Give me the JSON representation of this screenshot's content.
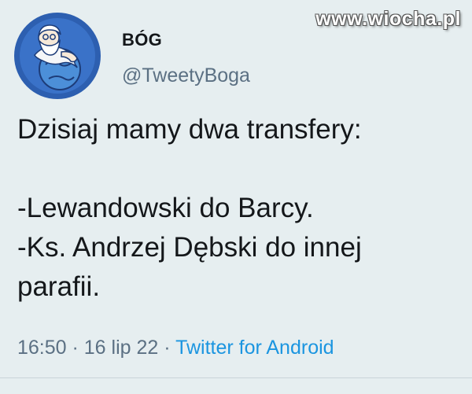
{
  "watermark": "www.wiocha.pl",
  "author": {
    "name": "BÓG",
    "handle": "@TweetyBoga",
    "avatar_icon": "god-figure-avatar"
  },
  "tweet": {
    "lines": [
      "Dzisiaj mamy dwa transfery:",
      "",
      "-Lewandowski do Barcy.",
      "-Ks. Andrzej Dębski do innej",
      "parafii."
    ]
  },
  "meta": {
    "time": "16:50",
    "separator": " · ",
    "date": "16 lip 22",
    "source": "Twitter for Android"
  },
  "colors": {
    "background": "#e6eef0",
    "text": "#14171a",
    "secondary": "#5b7083",
    "link": "#1b95e0"
  }
}
